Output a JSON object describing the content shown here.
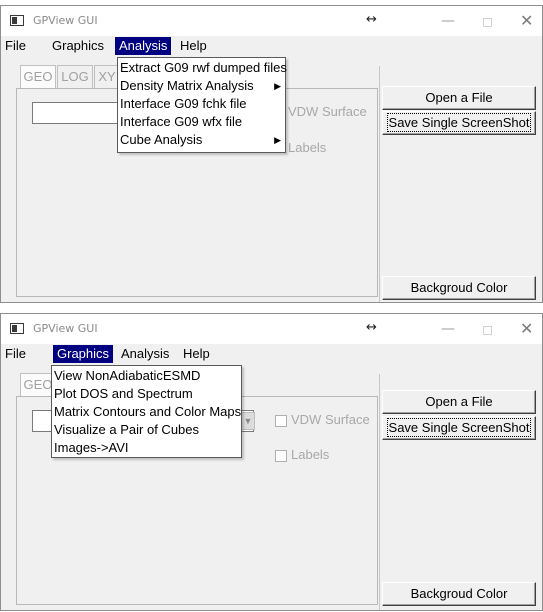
{
  "top": {
    "title": "GPView GUI",
    "resize_glyph": "↔",
    "minimize_glyph": "—",
    "close_glyph": "✕",
    "menus": [
      "File",
      "Graphics",
      "Analysis",
      "Help"
    ],
    "active_menu": "Analysis",
    "tabs": [
      "GEO",
      "LOG",
      "XY"
    ],
    "dropdown": [
      {
        "label": "Extract G09 rwf dumped files",
        "submenu": false
      },
      {
        "label": "Density Matrix Analysis",
        "submenu": true
      },
      {
        "label": "Interface G09 fchk file",
        "submenu": false
      },
      {
        "label": "Interface G09 wfx file",
        "submenu": false
      },
      {
        "label": "Cube Analysis",
        "submenu": true
      }
    ],
    "submenu_glyph": "▶",
    "checkboxes": [
      "VDW Surface",
      "Labels"
    ],
    "buttons": {
      "open": "Open a File",
      "save": "Save Single ScreenShot",
      "bg": "Backgroud Color"
    }
  },
  "bottom": {
    "title": "GPView GUI",
    "resize_glyph": "↔",
    "minimize_glyph": "—",
    "close_glyph": "✕",
    "menus": [
      "File",
      "Graphics",
      "Analysis",
      "Help"
    ],
    "active_menu": "Graphics",
    "tabs": [
      "GEO"
    ],
    "combo_arrow_glyph": "▼",
    "dropdown": [
      {
        "label": "View NonAdiabaticESMD",
        "submenu": false
      },
      {
        "label": "Plot DOS and Spectrum",
        "submenu": false
      },
      {
        "label": "Matrix Contours and Color Maps",
        "submenu": false
      },
      {
        "label": "Visualize a Pair of Cubes",
        "submenu": false
      },
      {
        "label": "Images->AVI",
        "submenu": false
      }
    ],
    "checkboxes": [
      "VDW Surface",
      "Labels"
    ],
    "buttons": {
      "open": "Open a File",
      "save": "Save Single ScreenShot",
      "bg": "Backgroud Color"
    }
  },
  "colors": {
    "menu_highlight": "#000080",
    "window_bg": "#f0f0f0",
    "disabled_text": "#a0a0a0"
  }
}
